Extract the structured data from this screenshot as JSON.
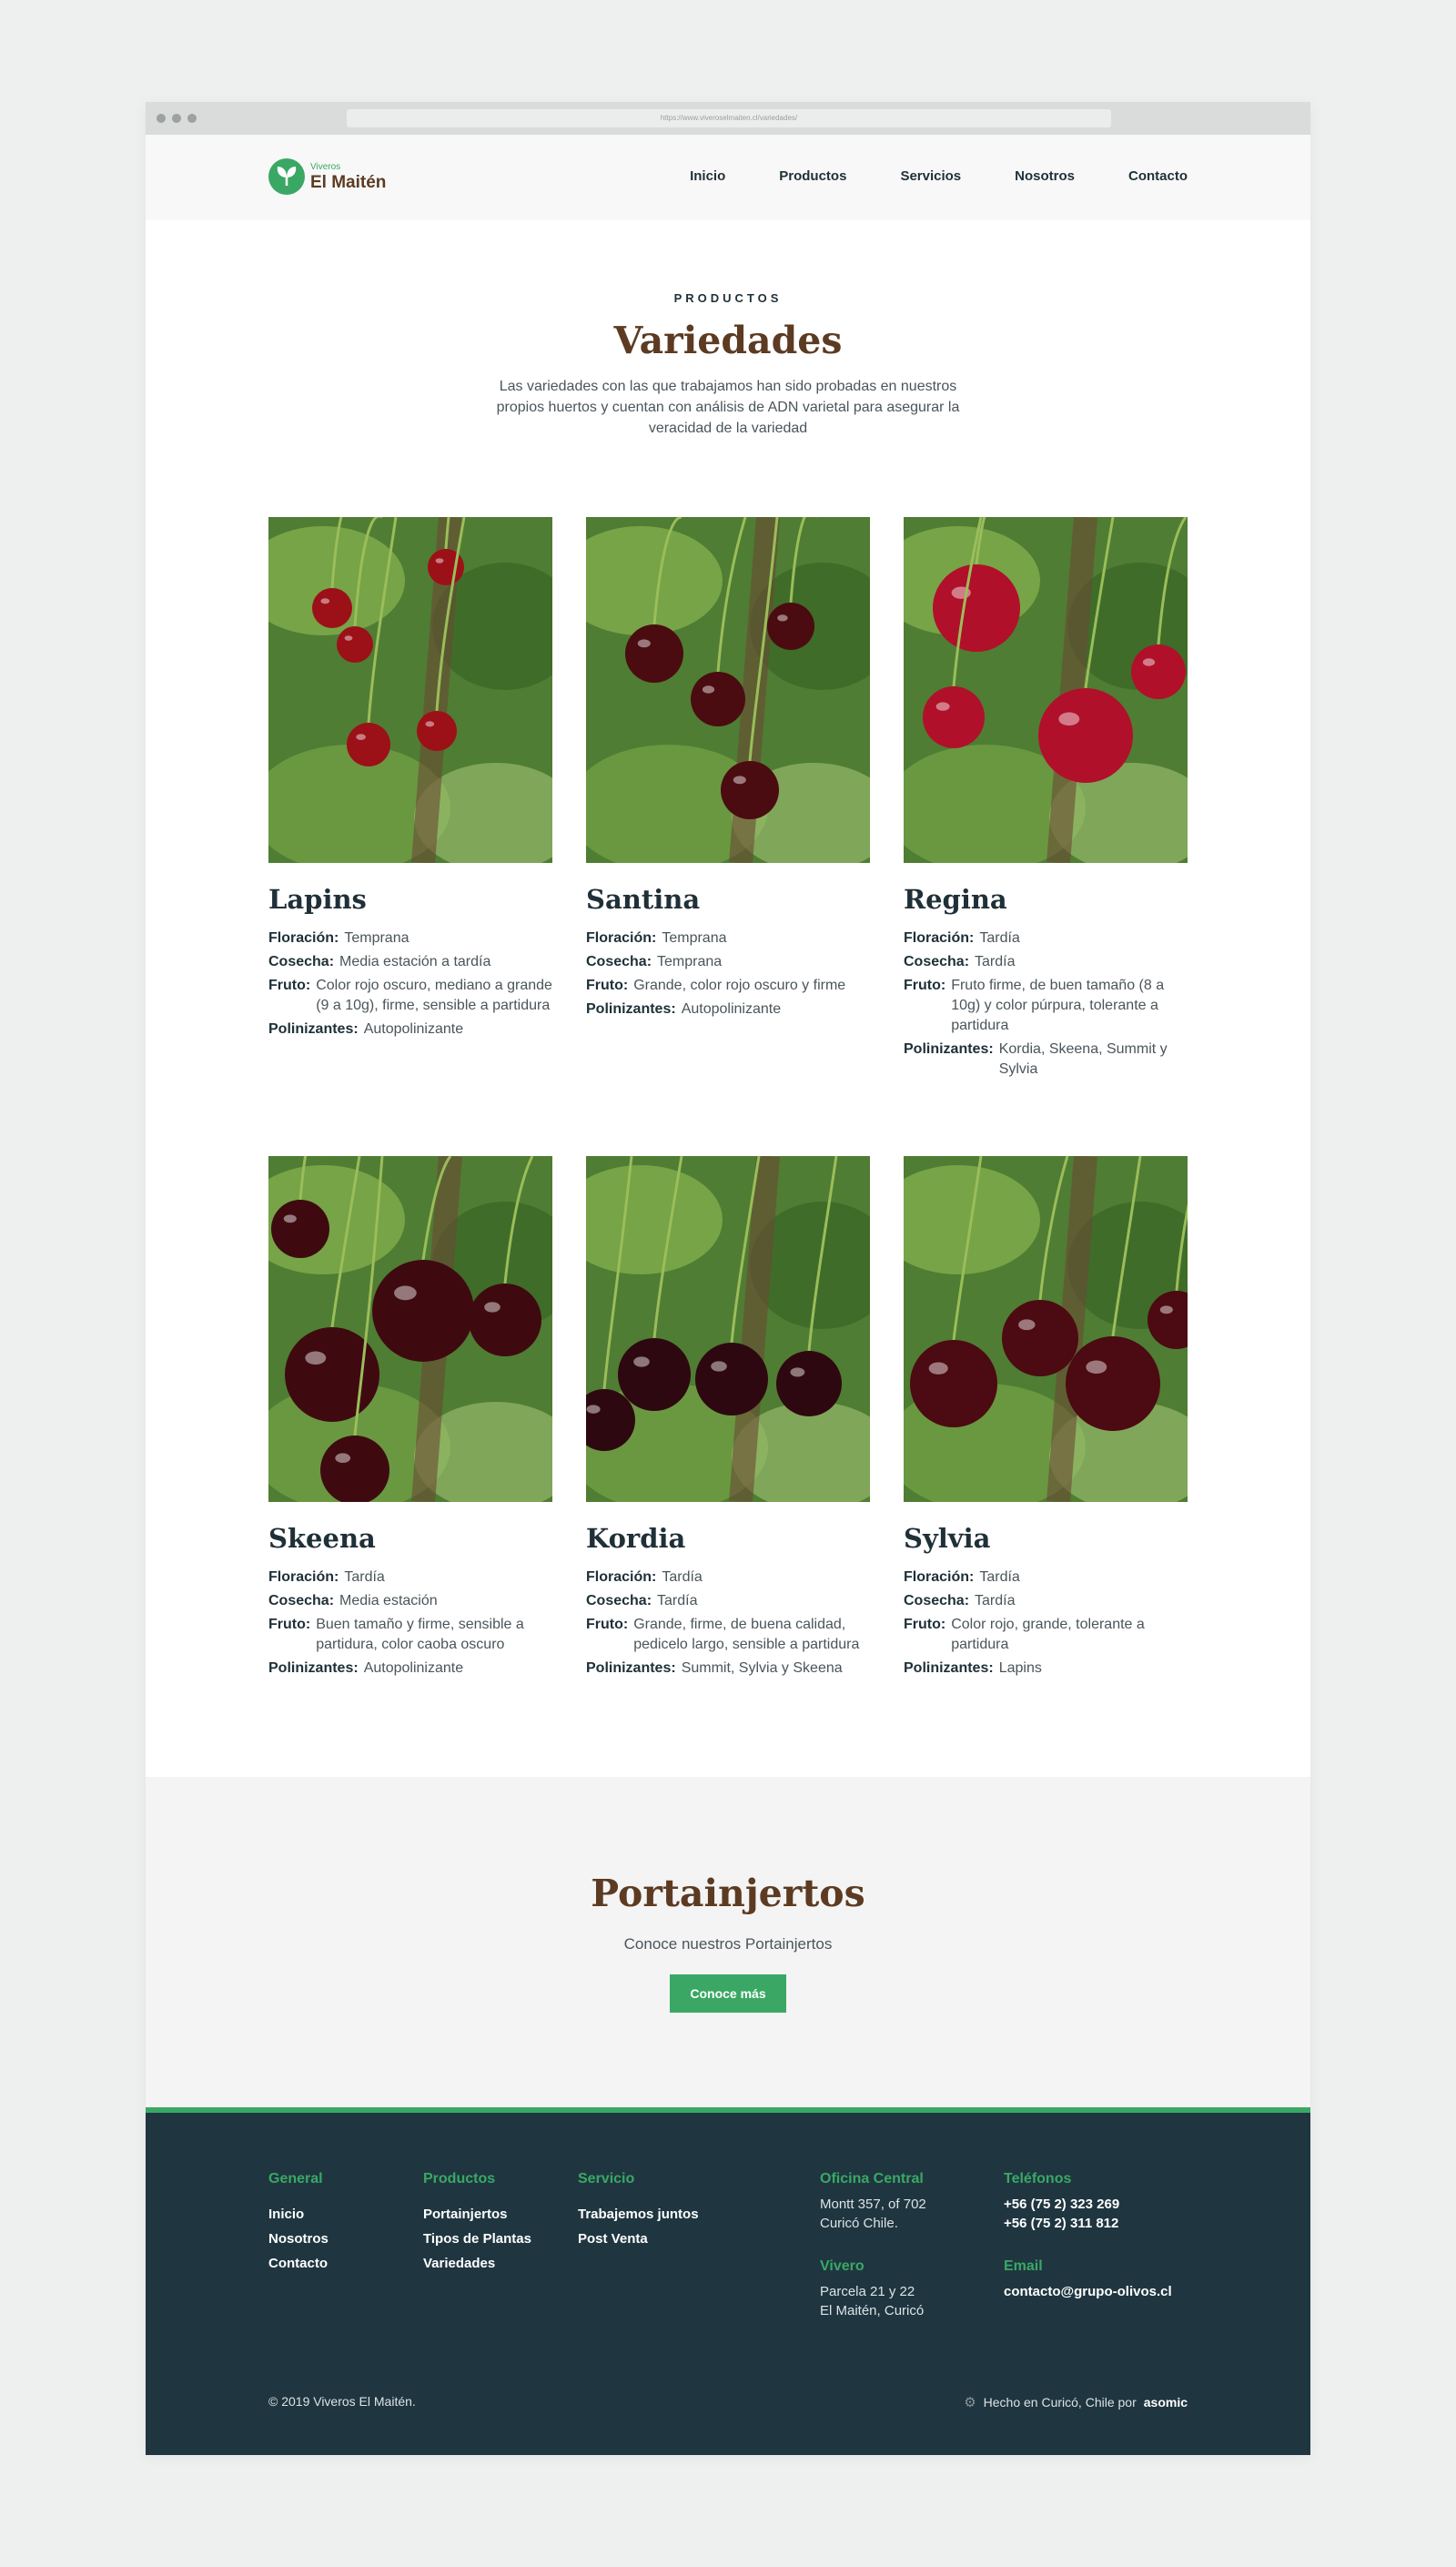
{
  "browser": {
    "url": "https://www.viveroselmaiten.cl/variedades/"
  },
  "header": {
    "logo_small": "Viveros",
    "logo_big": "El Maitén",
    "nav": [
      "Inicio",
      "Productos",
      "Servicios",
      "Nosotros",
      "Contacto"
    ]
  },
  "intro": {
    "eyebrow": "PRODUCTOS",
    "title": "Variedades",
    "text": "Las variedades con las que trabajamos han sido probadas en nuestros propios huertos y cuentan con análisis de ADN varietal para asegurar la veracidad de la variedad"
  },
  "labels": {
    "floracion": "Floración:",
    "cosecha": "Cosecha:",
    "fruto": "Fruto:",
    "polinizantes": "Polinizantes:"
  },
  "varieties": [
    {
      "name": "Lapins",
      "floracion": "Temprana",
      "cosecha": "Media estación a tardía",
      "fruto": "Color rojo oscuro, mediano a grande (9 a 10g), firme, sensible a partidura",
      "polinizantes": "Autopolinizante",
      "cherry_color": "#9c1018"
    },
    {
      "name": "Santina",
      "floracion": "Temprana",
      "cosecha": "Temprana",
      "fruto": "Grande, color rojo oscuro y firme",
      "polinizantes": "Autopolinizante",
      "cherry_color": "#4a0c10"
    },
    {
      "name": "Regina",
      "floracion": "Tardía",
      "cosecha": "Tardía",
      "fruto": "Fruto firme, de buen tamaño (8 a 10g) y color púrpura, tolerante a partidura",
      "polinizantes": "Kordia, Skeena, Summit y Sylvia",
      "cherry_color": "#b0102a"
    },
    {
      "name": "Skeena",
      "floracion": "Tardía",
      "cosecha": "Media estación",
      "fruto": "Buen tamaño y firme, sensible a partidura, color caoba oscuro",
      "polinizantes": "Autopolinizante",
      "cherry_color": "#3e0a10"
    },
    {
      "name": "Kordia",
      "floracion": "Tardía",
      "cosecha": "Tardía",
      "fruto": "Grande, firme, de buena calidad, pedicelo largo, sensible a partidura",
      "polinizantes": "Summit, Sylvia y Skeena",
      "cherry_color": "#2e0810"
    },
    {
      "name": "Sylvia",
      "floracion": "Tardía",
      "cosecha": "Tardía",
      "fruto": "Color rojo, grande, tolerante a partidura",
      "polinizantes": "Lapins",
      "cherry_color": "#4c0a12"
    }
  ],
  "rootstock": {
    "title": "Portainjertos",
    "subtitle": "Conoce nuestros Portainjertos",
    "button": "Conoce más"
  },
  "footer": {
    "general": {
      "heading": "General",
      "items": [
        "Inicio",
        "Nosotros",
        "Contacto"
      ]
    },
    "productos": {
      "heading": "Productos",
      "items": [
        "Portainjertos",
        "Tipos de Plantas",
        "Variedades"
      ]
    },
    "servicio": {
      "heading": "Servicio",
      "items": [
        "Trabajemos juntos",
        "Post Venta"
      ]
    },
    "oficina": {
      "heading": "Oficina Central",
      "line1": "Montt 357, of 702",
      "line2": "Curicó Chile."
    },
    "vivero": {
      "heading": "Vivero",
      "line1": "Parcela 21 y 22",
      "line2": "El Maitén, Curicó"
    },
    "telefonos": {
      "heading": "Teléfonos",
      "line1": "+56 (75 2) 323 269",
      "line2": "+56 (75 2) 311 812"
    },
    "email": {
      "heading": "Email",
      "value": "contacto@grupo-olivos.cl"
    },
    "copyright": "© 2019 Viveros El Maitén.",
    "made_text": "Hecho en Curicó, Chile por",
    "made_brand": "asomic"
  },
  "colors": {
    "green": "#3aa864",
    "brown": "#5c3b22",
    "dark": "#1f3640"
  }
}
